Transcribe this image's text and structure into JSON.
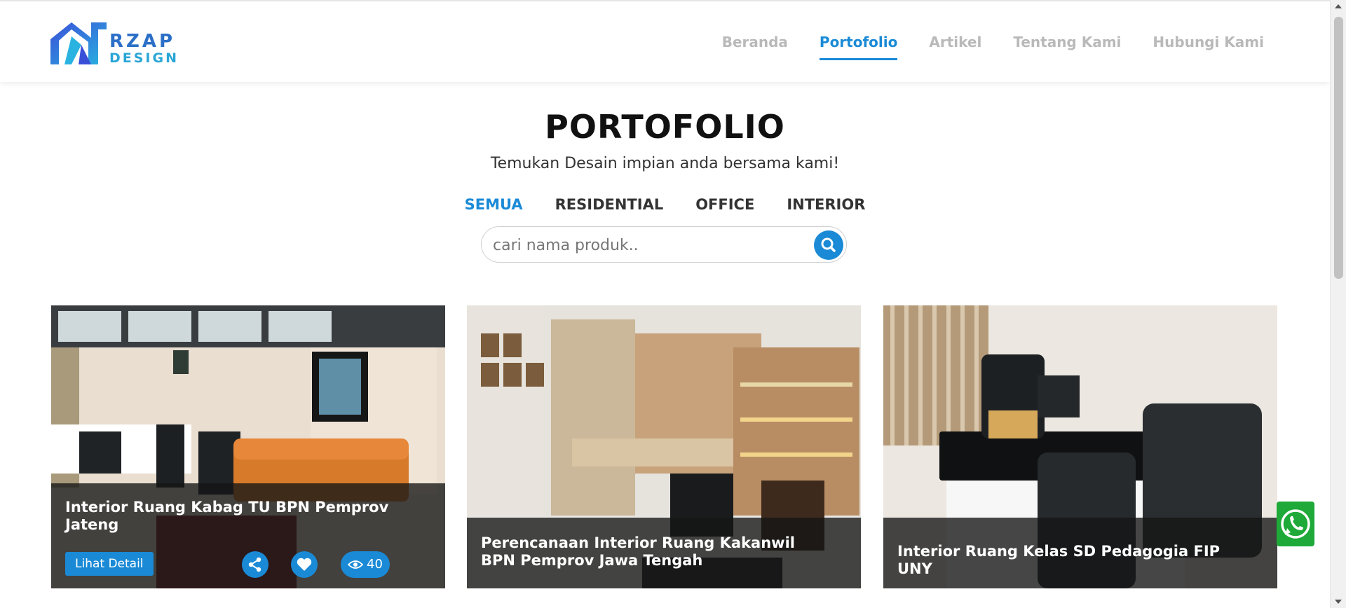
{
  "brand": {
    "line1": "RZAP",
    "line2": "DESIGN"
  },
  "nav": [
    {
      "label": "Beranda",
      "active": false
    },
    {
      "label": "Portofolio",
      "active": true
    },
    {
      "label": "Artikel",
      "active": false
    },
    {
      "label": "Tentang Kami",
      "active": false
    },
    {
      "label": "Hubungi Kami",
      "active": false
    }
  ],
  "section": {
    "title": "PORTOFOLIO",
    "subtitle": "Temukan Desain impian anda bersama kami!"
  },
  "filters": [
    {
      "label": "SEMUA",
      "active": true
    },
    {
      "label": "RESIDENTIAL",
      "active": false
    },
    {
      "label": "OFFICE",
      "active": false
    },
    {
      "label": "INTERIOR",
      "active": false
    }
  ],
  "search": {
    "placeholder": "cari nama produk.."
  },
  "cards": [
    {
      "title": "Interior Ruang Kabag TU BPN Pemprov Jateng",
      "detail_label": "Lihat Detail",
      "views": "40"
    },
    {
      "title": "Perencanaan Interior Ruang Kakanwil BPN Pemprov Jawa Tengah"
    },
    {
      "title": "Interior Ruang Kelas SD Pedagogia FIP UNY"
    }
  ],
  "colors": {
    "accent": "#1a8ad6",
    "whatsapp": "#1ea938"
  },
  "icons": {
    "share": "share-icon",
    "like": "heart-icon",
    "views": "eye-icon",
    "search": "search-icon",
    "whatsapp": "whatsapp-icon"
  }
}
